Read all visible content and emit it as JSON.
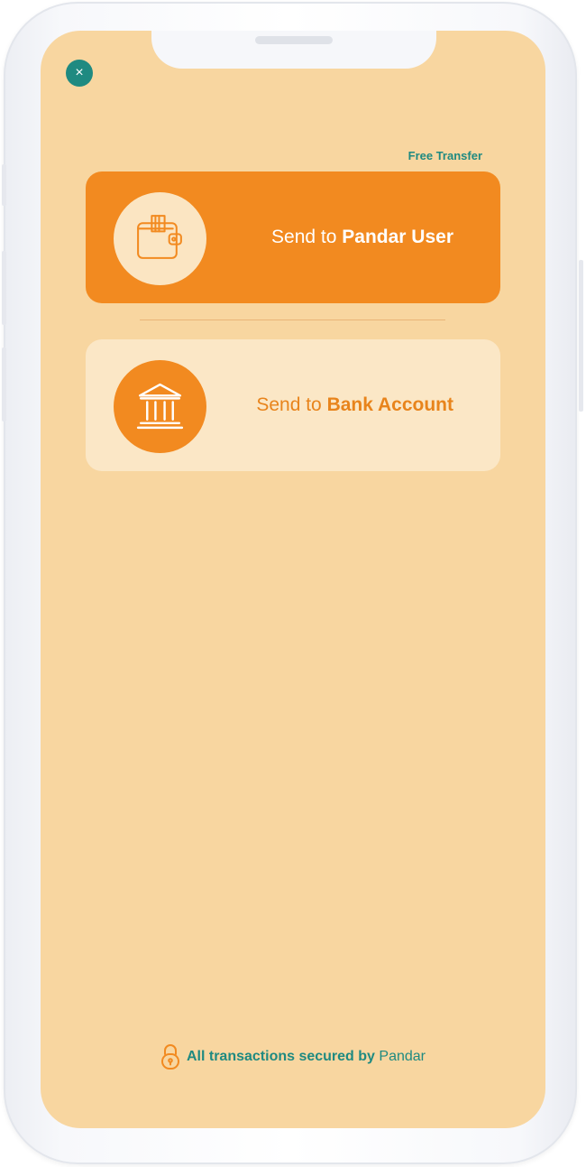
{
  "header": {
    "close_icon": "close-icon",
    "close_glyph": "×",
    "free_transfer_label": "Free Transfer"
  },
  "options": [
    {
      "icon": "wallet-icon",
      "label_prefix": "Send to ",
      "label_strong": "Pandar User"
    },
    {
      "icon": "bank-icon",
      "label_prefix": "Send to ",
      "label_strong": "Bank Account"
    }
  ],
  "footer": {
    "icon": "lock-icon",
    "text": "All transactions secured by",
    "brand": "Pandar"
  },
  "colors": {
    "background": "#f8d6a0",
    "accent": "#f28a20",
    "teal": "#1f8a81",
    "card_light": "#fbe7c6"
  }
}
